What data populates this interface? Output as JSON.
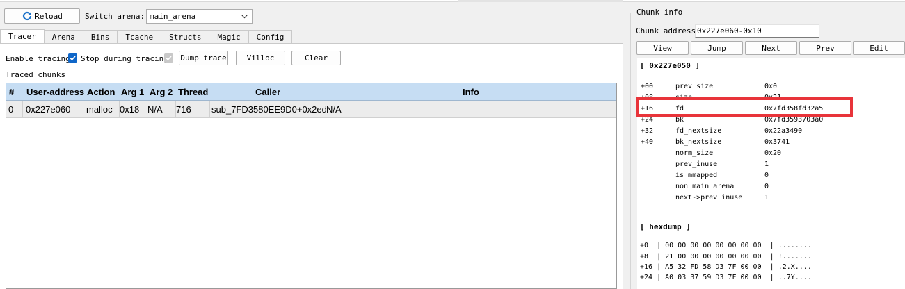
{
  "toolbar": {
    "reload_label": "Reload",
    "switch_arena_label": "Switch arena:",
    "arena_value": "main_arena"
  },
  "tabs": [
    {
      "label": "Tracer",
      "active": true
    },
    {
      "label": "Arena"
    },
    {
      "label": "Bins"
    },
    {
      "label": "Tcache"
    },
    {
      "label": "Structs"
    },
    {
      "label": "Magic"
    },
    {
      "label": "Config"
    }
  ],
  "tracer": {
    "enable_tracing_label": "Enable tracing",
    "enable_tracing_checked": true,
    "stop_during_label": "Stop during tracing",
    "stop_during_checked": true,
    "dump_trace_label": "Dump trace",
    "villoc_label": "Villoc",
    "clear_label": "Clear",
    "traced_chunks_label": "Traced chunks",
    "columns": [
      "#",
      "User-address",
      "Action",
      "Arg 1",
      "Arg 2",
      "Thread",
      "Caller",
      "Info"
    ],
    "rows": [
      [
        "0",
        "0x227e060",
        "malloc",
        "0x18",
        "N/A",
        "716",
        "sub_7FD3580EE9D0+0x2ed",
        "N/A"
      ]
    ]
  },
  "chunk_info": {
    "title": "Chunk info",
    "address_label": "Chunk address",
    "address_value": "0x227e060-0x10",
    "buttons": [
      "View",
      "Jump",
      "Next",
      "Prev",
      "Edit"
    ],
    "header": "[ 0x227e050 ]",
    "fields": [
      {
        "off": "+00",
        "name": "prev_size",
        "value": "0x0"
      },
      {
        "off": "+08",
        "name": "size",
        "value": "0x21"
      },
      {
        "off": "+16",
        "name": "fd",
        "value": "0x7fd358fd32a5"
      },
      {
        "off": "+24",
        "name": "bk",
        "value": "0x7fd3593703a0"
      },
      {
        "off": "+32",
        "name": "fd_nextsize",
        "value": "0x22a3490"
      },
      {
        "off": "+40",
        "name": "bk_nextsize",
        "value": "0x3741"
      },
      {
        "off": "",
        "name": "norm_size",
        "value": "0x20"
      },
      {
        "off": "",
        "name": "prev_inuse",
        "value": "1"
      },
      {
        "off": "",
        "name": "is_mmapped",
        "value": "0"
      },
      {
        "off": "",
        "name": "non_main_arena",
        "value": "0"
      },
      {
        "off": "",
        "name": "next->prev_inuse",
        "value": "1"
      }
    ],
    "hexdump_header": "[ hexdump ]",
    "hexdump": [
      "+0  | 00 00 00 00 00 00 00 00  | ........",
      "+8  | 21 00 00 00 00 00 00 00  | !.......",
      "+16 | A5 32 FD 58 D3 7F 00 00  | .2.X....",
      "+24 | A0 03 37 59 D3 7F 00 00  | ..7Y...."
    ]
  },
  "highlight_color": "#e8343a",
  "accent_color": "#0f66c8"
}
